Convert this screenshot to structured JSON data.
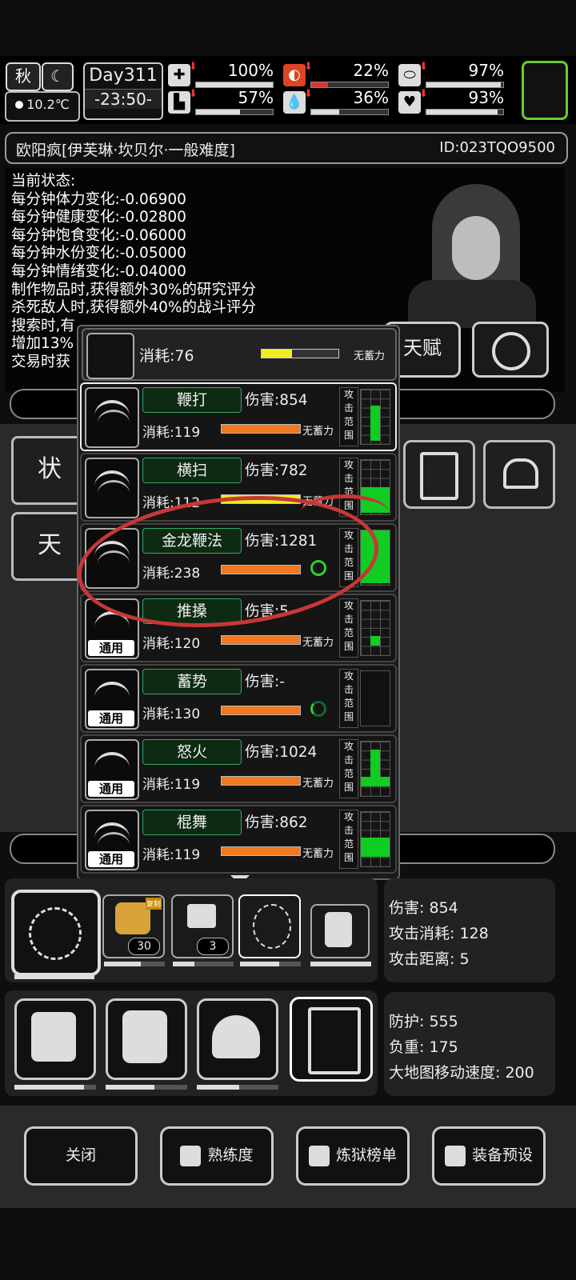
{
  "top": {
    "season": "秋",
    "temperature": "10.2℃",
    "day": "Day311",
    "time": "-23:50-",
    "stats": [
      {
        "icon": "medkit-icon",
        "percent": "100%",
        "fill": 1.0
      },
      {
        "icon": "stomach-icon",
        "percent": "22%",
        "fill": 0.22
      },
      {
        "icon": "pill-icon",
        "percent": "97%",
        "fill": 0.97
      },
      {
        "icon": "boot-icon",
        "percent": "57%",
        "fill": 0.57
      },
      {
        "icon": "water-drop-icon",
        "percent": "36%",
        "fill": 0.36
      },
      {
        "icon": "heart-icon",
        "percent": "93%",
        "fill": 0.93
      }
    ]
  },
  "character": {
    "name": "欧阳疯[伊芙琳·坎贝尔·一般难度]",
    "id": "ID:023TQO9500"
  },
  "status": {
    "heading": "当前状态:",
    "lines": [
      "每分钟体力变化:-0.06900",
      "每分钟健康变化:-0.02800",
      "每分钟饱食变化:-0.06000",
      "每分钟水份变化:-0.05000",
      "每分钟情绪变化:-0.04000",
      "制作物品时,获得额外30%的研究评分",
      "杀死敌人时,获得额外40%的战斗评分",
      "搜索时,有",
      "增加13%",
      "交易时获"
    ]
  },
  "buttons": {
    "talent": "天赋",
    "left_status": "状",
    "left_talent": "天"
  },
  "top_skill": {
    "cost": "消耗:76",
    "tag": "无蓄力"
  },
  "skills": [
    {
      "name": "鞭打",
      "damage": "伤害:854",
      "cost": "消耗:119",
      "tag": "无蓄力",
      "general": "",
      "range": "攻击范围"
    },
    {
      "name": "横扫",
      "damage": "伤害:782",
      "cost": "消耗:112",
      "tag": "无蓄力",
      "general": "",
      "range": "攻击范围"
    },
    {
      "name": "金龙鞭法",
      "damage": "伤害:1281",
      "cost": "消耗:238",
      "tag": "",
      "general": "",
      "range": "攻击范围"
    },
    {
      "name": "推搡",
      "damage": "伤害:5",
      "cost": "消耗:120",
      "tag": "无蓄力",
      "general": "通用",
      "range": "攻击范围"
    },
    {
      "name": "蓄势",
      "damage": "伤害:-",
      "cost": "消耗:130",
      "tag": "",
      "general": "通用",
      "range": "攻击范围"
    },
    {
      "name": "怒火",
      "damage": "伤害:1024",
      "cost": "消耗:119",
      "tag": "无蓄力",
      "general": "通用",
      "range": "攻击范围"
    },
    {
      "name": "棍舞",
      "damage": "伤害:862",
      "cost": "消耗:119",
      "tag": "无蓄力",
      "general": "通用",
      "range": "攻击范围"
    }
  ],
  "weapon": {
    "counts": [
      "30",
      "3"
    ],
    "badge": "复制",
    "info": [
      "伤害: 854",
      "攻击消耗: 128",
      "攻击距离: 5"
    ]
  },
  "armor_info": [
    "防护: 555",
    "负重: 175",
    "大地图移动速度: 200"
  ],
  "bottom": {
    "close": "关闭",
    "proficiency": "熟练度",
    "ranking": "炼狱榜单",
    "preset": "装备预设"
  }
}
